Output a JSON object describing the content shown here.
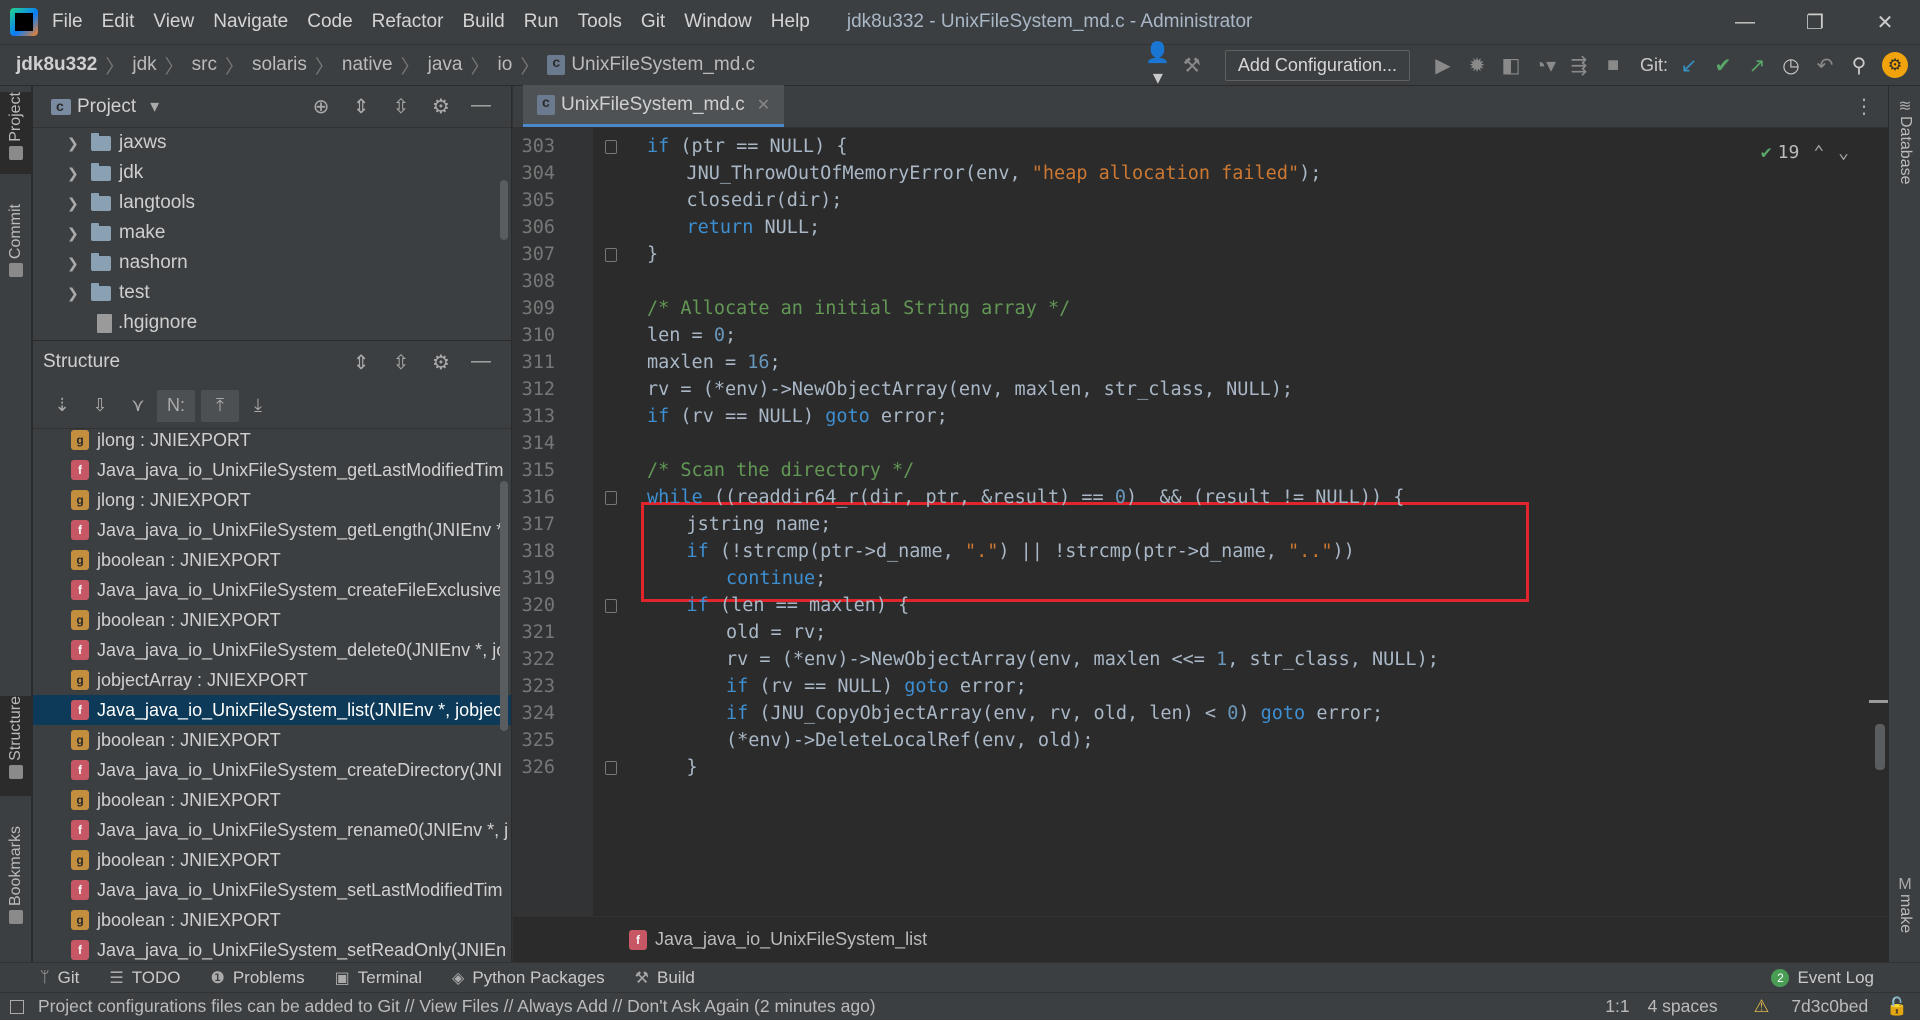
{
  "titlebar": {
    "menu": [
      "File",
      "Edit",
      "View",
      "Navigate",
      "Code",
      "Refactor",
      "Build",
      "Run",
      "Tools",
      "Git",
      "Window",
      "Help"
    ],
    "window_title": "jdk8u332 - UnixFileSystem_md.c - Administrator"
  },
  "navbar": {
    "crumbs": [
      "jdk8u332",
      "jdk",
      "src",
      "solaris",
      "native",
      "java",
      "io",
      "UnixFileSystem_md.c"
    ],
    "add_configuration": "Add Configuration...",
    "git_label": "Git:"
  },
  "left_strip": {
    "project": "Project",
    "commit": "Commit",
    "structure": "Structure",
    "bookmarks": "Bookmarks"
  },
  "right_strip": {
    "database": "Database",
    "make": "make"
  },
  "project_panel": {
    "title": "Project",
    "items": [
      {
        "label": "jaxws",
        "type": "folder"
      },
      {
        "label": "jdk",
        "type": "folder"
      },
      {
        "label": "langtools",
        "type": "folder"
      },
      {
        "label": "make",
        "type": "folder"
      },
      {
        "label": "nashorn",
        "type": "folder"
      },
      {
        "label": "test",
        "type": "folder"
      },
      {
        "label": ".hgignore",
        "type": "file"
      }
    ]
  },
  "structure_panel": {
    "title": "Structure",
    "items": [
      {
        "badge": "g",
        "label": "jlong : JNIEXPORT"
      },
      {
        "badge": "f",
        "label": "Java_java_io_UnixFileSystem_getLastModifiedTim"
      },
      {
        "badge": "g",
        "label": "jlong : JNIEXPORT"
      },
      {
        "badge": "f",
        "label": "Java_java_io_UnixFileSystem_getLength(JNIEnv *"
      },
      {
        "badge": "g",
        "label": "jboolean : JNIEXPORT"
      },
      {
        "badge": "f",
        "label": "Java_java_io_UnixFileSystem_createFileExclusivel"
      },
      {
        "badge": "g",
        "label": "jboolean : JNIEXPORT"
      },
      {
        "badge": "f",
        "label": "Java_java_io_UnixFileSystem_delete0(JNIEnv *, jo"
      },
      {
        "badge": "g",
        "label": "jobjectArray : JNIEXPORT"
      },
      {
        "badge": "f",
        "label": "Java_java_io_UnixFileSystem_list(JNIEnv *, jobject",
        "selected": true
      },
      {
        "badge": "g",
        "label": "jboolean : JNIEXPORT"
      },
      {
        "badge": "f",
        "label": "Java_java_io_UnixFileSystem_createDirectory(JNI"
      },
      {
        "badge": "g",
        "label": "jboolean : JNIEXPORT"
      },
      {
        "badge": "f",
        "label": "Java_java_io_UnixFileSystem_rename0(JNIEnv *, j"
      },
      {
        "badge": "g",
        "label": "jboolean : JNIEXPORT"
      },
      {
        "badge": "f",
        "label": "Java_java_io_UnixFileSystem_setLastModifiedTim"
      },
      {
        "badge": "g",
        "label": "jboolean : JNIEXPORT"
      },
      {
        "badge": "f",
        "label": "Java_java_io_UnixFileSystem_setReadOnly(JNIEn"
      }
    ]
  },
  "editor": {
    "tab_label": "UnixFileSystem_md.c",
    "inspection_count": "19",
    "lines": [
      {
        "n": "303",
        "indent": 1,
        "fold": true,
        "tokens": [
          [
            "kw",
            "if"
          ],
          [
            "t",
            " (ptr == NULL) {"
          ]
        ]
      },
      {
        "n": "304",
        "indent": 2,
        "fold": false,
        "tokens": [
          [
            "t",
            "JNU_ThrowOutOfMemoryError(env, "
          ],
          [
            "str",
            "\"heap allocation failed\""
          ],
          [
            "t",
            ");"
          ]
        ]
      },
      {
        "n": "305",
        "indent": 2,
        "fold": false,
        "tokens": [
          [
            "t",
            "closedir(dir);"
          ]
        ]
      },
      {
        "n": "306",
        "indent": 2,
        "fold": false,
        "tokens": [
          [
            "kw",
            "return"
          ],
          [
            "t",
            " NULL;"
          ]
        ]
      },
      {
        "n": "307",
        "indent": 1,
        "fold": true,
        "tokens": [
          [
            "t",
            "}"
          ]
        ]
      },
      {
        "n": "308",
        "indent": 0,
        "fold": false,
        "tokens": []
      },
      {
        "n": "309",
        "indent": 1,
        "fold": false,
        "tokens": [
          [
            "cmt",
            "/* Allocate an initial String array */"
          ]
        ]
      },
      {
        "n": "310",
        "indent": 1,
        "fold": false,
        "tokens": [
          [
            "t",
            "len = "
          ],
          [
            "num",
            "0"
          ],
          [
            "t",
            ";"
          ]
        ]
      },
      {
        "n": "311",
        "indent": 1,
        "fold": false,
        "tokens": [
          [
            "t",
            "maxlen = "
          ],
          [
            "num",
            "16"
          ],
          [
            "t",
            ";"
          ]
        ]
      },
      {
        "n": "312",
        "indent": 1,
        "fold": false,
        "tokens": [
          [
            "t",
            "rv = (*env)->NewObjectArray(env, maxlen, str_class, NULL);"
          ]
        ]
      },
      {
        "n": "313",
        "indent": 1,
        "fold": false,
        "tokens": [
          [
            "kw",
            "if"
          ],
          [
            "t",
            " (rv == NULL) "
          ],
          [
            "kw",
            "goto"
          ],
          [
            "t",
            " error;"
          ]
        ]
      },
      {
        "n": "314",
        "indent": 0,
        "fold": false,
        "tokens": []
      },
      {
        "n": "315",
        "indent": 1,
        "fold": false,
        "tokens": [
          [
            "cmt",
            "/* Scan the directory */"
          ]
        ]
      },
      {
        "n": "316",
        "indent": 1,
        "fold": true,
        "tokens": [
          [
            "kw",
            "while"
          ],
          [
            "t",
            " ((readdir64_r(dir, ptr, &result) == "
          ],
          [
            "num",
            "0"
          ],
          [
            "t",
            ")  && (result != NULL)) {"
          ]
        ]
      },
      {
        "n": "317",
        "indent": 2,
        "fold": false,
        "tokens": [
          [
            "t",
            "jstring name;"
          ]
        ]
      },
      {
        "n": "318",
        "indent": 2,
        "fold": false,
        "tokens": [
          [
            "kw",
            "if"
          ],
          [
            "t",
            " (!strcmp(ptr->d_name, "
          ],
          [
            "str",
            "\".\""
          ],
          [
            "t",
            ") || !strcmp(ptr->d_name, "
          ],
          [
            "str",
            "\"..\""
          ],
          [
            "t",
            "))"
          ]
        ]
      },
      {
        "n": "319",
        "indent": 3,
        "fold": false,
        "tokens": [
          [
            "kw",
            "continue"
          ],
          [
            "t",
            ";"
          ]
        ]
      },
      {
        "n": "320",
        "indent": 2,
        "fold": true,
        "tokens": [
          [
            "kw",
            "if"
          ],
          [
            "t",
            " (len == maxlen) {"
          ]
        ]
      },
      {
        "n": "321",
        "indent": 3,
        "fold": false,
        "tokens": [
          [
            "t",
            "old = rv;"
          ]
        ]
      },
      {
        "n": "322",
        "indent": 3,
        "fold": false,
        "tokens": [
          [
            "t",
            "rv = (*env)->NewObjectArray(env, maxlen <<= "
          ],
          [
            "num",
            "1"
          ],
          [
            "t",
            ", str_class, NULL);"
          ]
        ]
      },
      {
        "n": "323",
        "indent": 3,
        "fold": false,
        "tokens": [
          [
            "kw",
            "if"
          ],
          [
            "t",
            " (rv == NULL) "
          ],
          [
            "kw",
            "goto"
          ],
          [
            "t",
            " error;"
          ]
        ]
      },
      {
        "n": "324",
        "indent": 3,
        "fold": false,
        "tokens": [
          [
            "kw",
            "if"
          ],
          [
            "t",
            " (JNU_CopyObjectArray(env, rv, old, len) < "
          ],
          [
            "num",
            "0"
          ],
          [
            "t",
            ") "
          ],
          [
            "kw",
            "goto"
          ],
          [
            "t",
            " error;"
          ]
        ]
      },
      {
        "n": "325",
        "indent": 3,
        "fold": false,
        "tokens": [
          [
            "t",
            "(*env)->DeleteLocalRef(env, old);"
          ]
        ]
      },
      {
        "n": "326",
        "indent": 2,
        "fold": true,
        "tokens": [
          [
            "t",
            "}"
          ]
        ]
      }
    ],
    "breadcrumb_badge": "f",
    "breadcrumb": "Java_java_io_UnixFileSystem_list"
  },
  "bottom_tools": [
    {
      "icon": "git-icon",
      "glyph": "ᛘ",
      "label": "Git"
    },
    {
      "icon": "todo-icon",
      "glyph": "☰",
      "label": "TODO"
    },
    {
      "icon": "problems-icon",
      "glyph": "❶",
      "label": "Problems"
    },
    {
      "icon": "terminal-icon",
      "glyph": "▣",
      "label": "Terminal"
    },
    {
      "icon": "python-packages-icon",
      "glyph": "◈",
      "label": "Python Packages"
    },
    {
      "icon": "build-icon",
      "glyph": "⚒",
      "label": "Build"
    }
  ],
  "event_log": {
    "count": "2",
    "label": "Event Log"
  },
  "statusbar": {
    "message": "Project configurations files can be added to Git // View Files // Always Add // Don't Ask Again (2 minutes ago)",
    "position": "1:1",
    "indent": "4 spaces",
    "vcs": "7d3c0bed"
  },
  "colors": {
    "selection": "#0d3a58",
    "highlight_box": "#e2252b",
    "keyword": "#3d8fd1",
    "string": "#cc7832",
    "comment": "#629755",
    "number": "#6897bb"
  }
}
